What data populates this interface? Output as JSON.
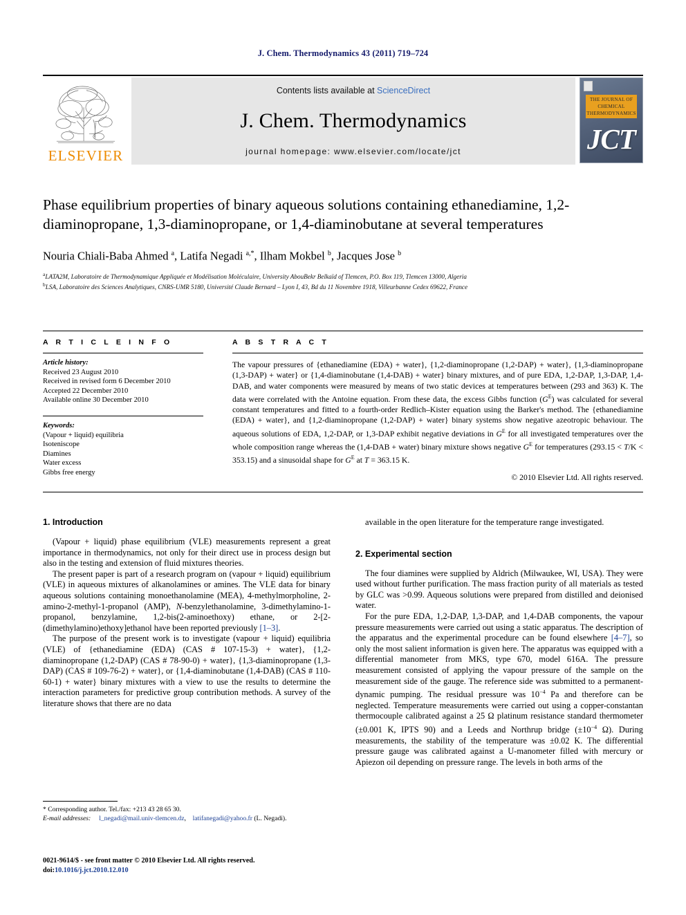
{
  "running_head": "J. Chem. Thermodynamics 43 (2011) 719–724",
  "masthead": {
    "publisher_name": "ELSEVIER",
    "contents_prefix": "Contents lists available at ",
    "contents_link": "ScienceDirect",
    "journal_title": "J. Chem. Thermodynamics",
    "homepage": "journal homepage: www.elsevier.com/locate/jct",
    "cover_title": "THE JOURNAL OF CHEMICAL THERMODYNAMICS",
    "cover_abbrev": "JCT",
    "accent_orange": "#ED8B00",
    "link_blue": "#3a6fbf",
    "cover_band": "#E8A020"
  },
  "article": {
    "title": "Phase equilibrium properties of binary aqueous solutions containing ethanediamine, 1,2-diaminopropane, 1,3-diaminopropane, or 1,4-diaminobutane at several temperatures",
    "authors_html": "Nouria Chiali-Baba Ahmed <sup>a</sup>, Latifa Negadi <sup>a,*</sup>, Ilham Mokbel <sup>b</sup>, Jacques Jose <sup>b</sup>",
    "affiliations": [
      {
        "marker": "a",
        "text": "LATA2M, Laboratoire de Thermodynamique Appliquée et Modélisation Moléculaire, University AbouBekr Belkaïd of Tlemcen, P.O. Box 119, Tlemcen 13000, Algeria"
      },
      {
        "marker": "b",
        "text": "LSA, Laboratoire des Sciences Analytiques, CNRS-UMR 5180, Université Claude Bernard – Lyon I, 43, Bd du 11 Novembre 1918, Villeurbanne Cedex 69622, France"
      }
    ]
  },
  "article_info": {
    "heading": "A R T I C L E    I N F O",
    "history_label": "Article history:",
    "history": [
      "Received 23 August 2010",
      "Received in revised form 6 December 2010",
      "Accepted 22 December 2010",
      "Available online 30 December 2010"
    ],
    "keywords_label": "Keywords:",
    "keywords": [
      "(Vapour + liquid) equilibria",
      "Isoteniscope",
      "Diamines",
      "Water excess",
      "Gibbs free energy"
    ]
  },
  "abstract": {
    "heading": "A B S T R A C T",
    "body_html": "The vapour pressures of {ethanediamine (EDA) + water}, {1,2-diaminopropane (1,2-DAP) + water}, {1,3-diaminopropane (1,3-DAP) + water} or {1,4-diaminobutane (1,4-DAB) + water} binary mixtures, and of pure EDA, 1,2-DAP, 1,3-DAP, 1,4-DAB, and water components were measured by means of two static devices at temperatures between (293 and 363) K. The data were correlated with the Antoine equation. From these data, the excess Gibbs function (<span class=\"ital\">G</span><sup class=\"sm\">E</sup>) was calculated for several constant temperatures and fitted to a fourth-order Redlich–Kister equation using the Barker's method. The {ethanediamine (EDA) + water}, and {1,2-diaminopropane (1,2-DAP) + water} binary systems show negative azeotropic behaviour. The aqueous solutions of EDA, 1,2-DAP, or 1,3-DAP exhibit negative deviations in <span class=\"ital\">G</span><sup class=\"sm\">E</sup> for all investigated temperatures over the whole composition range whereas the (1,4-DAB + water) binary mixture shows negative <span class=\"ital\">G</span><sup class=\"sm\">E</sup> for temperatures (293.15 &lt; <span class=\"ital\">T</span>/K &lt; 353.15) and a sinusoidal shape for <span class=\"ital\">G</span><sup class=\"sm\">E</sup> at <span class=\"ital\">T</span> = 363.15 K.",
    "copyright": "© 2010 Elsevier Ltd. All rights reserved."
  },
  "sections": {
    "intro_heading": "1. Introduction",
    "intro_p1": "(Vapour + liquid) phase equilibrium (VLE) measurements represent a great importance in thermodynamics, not only for their direct use in process design but also in the testing and extension of fluid mixtures theories.",
    "intro_p2_html": "The present paper is part of a research program on (vapour + liquid) equilibrium (VLE) in aqueous mixtures of alkanolamines or amines. The VLE data for binary aqueous solutions containing monoethanolamine (MEA), 4-methylmorpholine, 2-amino-2-methyl-1-propanol (AMP), <span class=\"ital\">N</span>-benzylethanolamine, 3-dimethylamino-1-propanol, benzylamine, 1,2-bis(2-aminoethoxy) ethane, or 2-[2-(dimethylamino)ethoxy]ethanol have been reported previously <span class=\"ref\">[1–3]</span>.",
    "intro_p3_html": "The purpose of the present work is to investigate (vapour + liquid) equilibria (VLE) of {ethanediamine (EDA) (CAS # 107-15-3) + water}, {1,2-diaminopropane (1,2-DAP) (CAS # 78-90-0) + water}, {1,3-diaminopropane (1,3-DAP) (CAS # 109-76-2) + water}, or {1,4-diaminobutane (1,4-DAB) (CAS # 110-60-1) + water} binary mixtures with a view to use the results to determine the interaction parameters for predictive group contribution methods. A survey of the literature shows that there are no data",
    "right_p1": "available in the open literature for the temperature range investigated.",
    "exp_heading": "2. Experimental section",
    "exp_p1": "The four diamines were supplied by Aldrich (Milwaukee, WI, USA). They were used without further purification. The mass fraction purity of all materials as tested by GLC was >0.99. Aqueous solutions were prepared from distilled and deionised water.",
    "exp_p2_html": "For the pure EDA, 1,2-DAP, 1,3-DAP, and 1,4-DAB components, the vapour pressure measurements were carried out using a static apparatus. The description of the apparatus and the experimental procedure can be found elsewhere <span class=\"ref\">[4–7]</span>, so only the most salient information is given here. The apparatus was equipped with a differential manometer from MKS, type 670, model 616A. The pressure measurement consisted of applying the vapour pressure of the sample on the measurement side of the gauge. The reference side was submitted to a permanent-dynamic pumping. The residual pressure was 10<sup class=\"sm\">−4</sup> Pa and therefore can be neglected. Temperature measurements were carried out using a copper-constantan thermocouple calibrated against a 25 Ω platinum resistance standard thermometer (±0.001 K, IPTS 90) and a Leeds and Northrup bridge (±10<sup class=\"sm\">−4</sup> Ω). During measurements, the stability of the temperature was ±0.02 K. The differential pressure gauge was calibrated against a U-manometer filled with mercury or Apiezon oil depending on pressure range. The levels in both arms of the"
  },
  "footnotes": {
    "corresponding": "* Corresponding author. Tel./fax: +213 43 28 65 30.",
    "email_label": "E-mail addresses:",
    "email1": "l_negadi@mail.univ-tlemcen.dz",
    "email2": "latifanegadi@yahoo.fr",
    "email_owner": "(L. Negadi)."
  },
  "footer": {
    "line1": "0021-9614/$ - see front matter © 2010 Elsevier Ltd. All rights reserved.",
    "doi_label": "doi:",
    "doi_value": "10.1016/j.jct.2010.12.010"
  }
}
